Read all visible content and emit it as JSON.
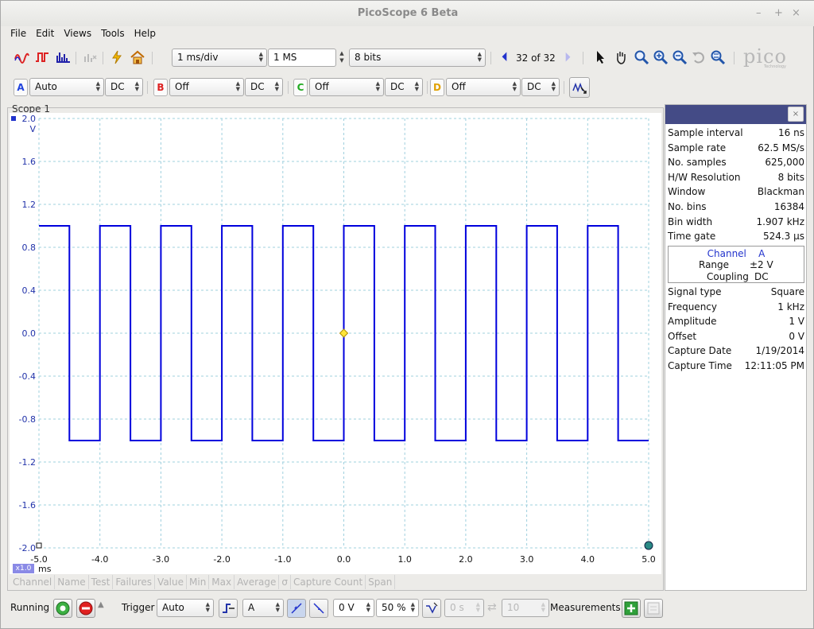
{
  "window": {
    "title": "PicoScope 6 Beta",
    "controls": [
      "–",
      "+",
      "×"
    ]
  },
  "menu": [
    "File",
    "Edit",
    "Views",
    "Tools",
    "Help"
  ],
  "toolbar": {
    "timebase": "1 ms/div",
    "samples": "1 MS",
    "resolution": "8 bits",
    "buffer": "32 of 32",
    "logo": "pico",
    "logo_sub": "Technology"
  },
  "channels": [
    {
      "letter": "A",
      "range": "Auto",
      "coupling": "DC",
      "color": "#2244dd"
    },
    {
      "letter": "B",
      "range": "Off",
      "coupling": "DC",
      "color": "#dd2222"
    },
    {
      "letter": "C",
      "range": "Off",
      "coupling": "DC",
      "color": "#22aa22"
    },
    {
      "letter": "D",
      "range": "Off",
      "coupling": "DC",
      "color": "#e0a000"
    }
  ],
  "scope": {
    "title": "Scope 1",
    "y_unit": "V",
    "x_unit": "ms",
    "zoom": "x1.0",
    "trace_color": "#0000dd"
  },
  "chart_data": {
    "type": "line",
    "title": "",
    "xlabel": "ms",
    "ylabel": "V",
    "xlim": [
      -5.0,
      5.0
    ],
    "ylim": [
      -2.0,
      2.0
    ],
    "x_ticks": [
      "-5.0",
      "-4.0",
      "-3.0",
      "-2.0",
      "-1.0",
      "0.0",
      "1.0",
      "2.0",
      "3.0",
      "4.0",
      "5.0"
    ],
    "y_ticks": [
      "2.0",
      "1.6",
      "1.2",
      "0.8",
      "0.4",
      "0.0",
      "-0.4",
      "-0.8",
      "-1.2",
      "-1.6",
      "-2.0"
    ],
    "grid": true,
    "series": [
      {
        "name": "A",
        "x": [
          -5.0,
          -4.5,
          -4.5,
          -4.0,
          -4.0,
          -3.5,
          -3.5,
          -3.0,
          -3.0,
          -2.5,
          -2.5,
          -2.0,
          -2.0,
          -1.5,
          -1.5,
          -1.0,
          -1.0,
          -0.5,
          -0.5,
          0.0,
          0.0,
          0.5,
          0.5,
          1.0,
          1.0,
          1.5,
          1.5,
          2.0,
          2.0,
          2.5,
          2.5,
          3.0,
          3.0,
          3.5,
          3.5,
          4.0,
          4.0,
          4.5,
          4.5,
          5.0
        ],
        "values": [
          1.0,
          1.0,
          -1.0,
          -1.0,
          1.0,
          1.0,
          -1.0,
          -1.0,
          1.0,
          1.0,
          -1.0,
          -1.0,
          1.0,
          1.0,
          -1.0,
          -1.0,
          1.0,
          1.0,
          -1.0,
          -1.0,
          1.0,
          1.0,
          -1.0,
          -1.0,
          1.0,
          1.0,
          -1.0,
          -1.0,
          1.0,
          1.0,
          -1.0,
          -1.0,
          1.0,
          1.0,
          -1.0,
          -1.0,
          1.0,
          1.0,
          -1.0,
          -1.0
        ]
      }
    ]
  },
  "measurements_columns": [
    "Channel",
    "Name",
    "Test",
    "Failures",
    "Value",
    "Min",
    "Max",
    "Average",
    "σ",
    "Capture Count",
    "Span"
  ],
  "info": {
    "rows_top": [
      {
        "k": "Sample interval",
        "v": "16 ns"
      },
      {
        "k": "Sample rate",
        "v": "62.5 MS/s"
      },
      {
        "k": "No. samples",
        "v": "625,000"
      },
      {
        "k": "H/W Resolution",
        "v": "8 bits"
      },
      {
        "k": "Window",
        "v": "Blackman"
      },
      {
        "k": "No. bins",
        "v": "16384"
      },
      {
        "k": "Bin width",
        "v": "1.907 kHz"
      },
      {
        "k": "Time gate",
        "v": "524.3 µs"
      }
    ],
    "channel_box": {
      "title_label": "Channel",
      "title_value": "A",
      "range_label": "Range",
      "range_value": "±2 V",
      "coupling_label": "Coupling",
      "coupling_value": "DC"
    },
    "rows_bottom": [
      {
        "k": "Signal type",
        "v": "Square"
      },
      {
        "k": "Frequency",
        "v": "1 kHz"
      },
      {
        "k": "Amplitude",
        "v": "1 V"
      },
      {
        "k": "Offset",
        "v": "0 V"
      },
      {
        "k": "Capture Date",
        "v": "1/19/2014"
      },
      {
        "k": "Capture Time",
        "v": "12:11:05 PM"
      }
    ]
  },
  "status": {
    "running": "Running",
    "trigger_label": "Trigger",
    "trigger_mode": "Auto",
    "trigger_channel": "A",
    "trigger_level": "0 V",
    "trigger_position": "50 %",
    "delay": "0 s",
    "count": "10",
    "measurements_label": "Measurements"
  }
}
